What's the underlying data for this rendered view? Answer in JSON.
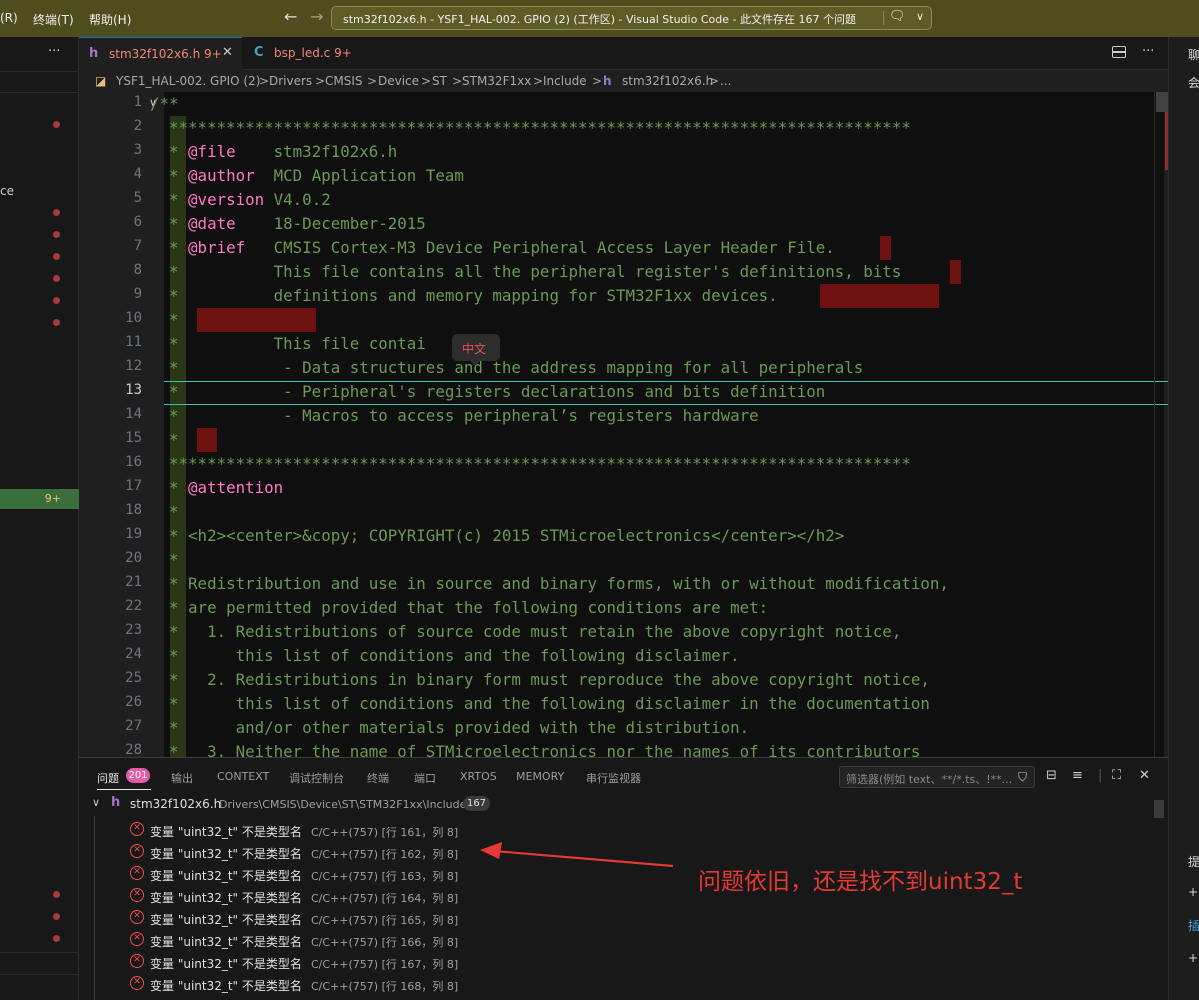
{
  "titlebar": {
    "menu_items": [
      "(R)",
      "终端(T)",
      "帮助(H)"
    ],
    "window_title": "stm32f102x6.h - YSF1_HAL-002. GPIO (2) (工作区) - Visual Studio Code - 此文件存在 167 个问题",
    "back_icon": "arrow-left-icon",
    "forward_icon": "arrow-right-icon"
  },
  "sidebar": {
    "more": "···",
    "fragment": "ce",
    "active_badge": "9+"
  },
  "tabs": [
    {
      "name": "stm32f102x6.h",
      "badge": "9+",
      "icon": "h",
      "close": "✕"
    },
    {
      "name": "bsp_led.c",
      "badge": "9+",
      "icon": "C"
    }
  ],
  "tabs_more": "···",
  "breadcrumb": [
    "YSF1_HAL-002. GPIO (2)",
    "Drivers",
    "CMSIS",
    "Device",
    "ST",
    "STM32F1xx",
    "Include",
    "stm32f102x6.h",
    "..."
  ],
  "breadcrumb_sep": ">",
  "breadcrumb_file_icon": "h",
  "editor": {
    "active_line": 13,
    "fold_icon": "∨",
    "tooltip": "中文",
    "lines": [
      {
        "num": "1",
        "text": "/**"
      },
      {
        "num": "2",
        "text": "  ******************************************************************************"
      },
      {
        "num": "3",
        "pre": "  * ",
        "tag": "@file",
        "text": "    stm32f102x6.h"
      },
      {
        "num": "4",
        "pre": "  * ",
        "tag": "@author",
        "text": "  MCD Application Team"
      },
      {
        "num": "5",
        "pre": "  * ",
        "tag": "@version",
        "text": " V4.0.2"
      },
      {
        "num": "6",
        "pre": "  * ",
        "tag": "@date",
        "text": "    18-December-2015"
      },
      {
        "num": "7",
        "pre": "  * ",
        "tag": "@brief",
        "text": "   CMSIS Cortex-M3 Device Peripheral Access Layer Header File."
      },
      {
        "num": "8",
        "text": "  *          This file contains all the peripheral register's definitions, bits"
      },
      {
        "num": "9",
        "text": "  *          definitions and memory mapping for STM32F1xx devices."
      },
      {
        "num": "10",
        "text": "  *"
      },
      {
        "num": "11",
        "text": "  *          This file contai"
      },
      {
        "num": "12",
        "text": "  *           - Data structures and the address mapping for all peripherals"
      },
      {
        "num": "13",
        "text": "  *           - Peripheral's registers declarations and bits definition"
      },
      {
        "num": "14",
        "text": "  *           - Macros to access peripheral’s registers hardware"
      },
      {
        "num": "15",
        "text": "  *"
      },
      {
        "num": "16",
        "text": "  ******************************************************************************"
      },
      {
        "num": "17",
        "pre": "  * ",
        "tag": "@attention",
        "text": ""
      },
      {
        "num": "18",
        "text": "  *"
      },
      {
        "num": "19",
        "text": "  * <h2><center>&copy; COPYRIGHT(c) 2015 STMicroelectronics</center></h2>"
      },
      {
        "num": "20",
        "text": "  *"
      },
      {
        "num": "21",
        "text": "  * Redistribution and use in source and binary forms, with or without modification,"
      },
      {
        "num": "22",
        "text": "  * are permitted provided that the following conditions are met:"
      },
      {
        "num": "23",
        "text": "  *   1. Redistributions of source code must retain the above copyright notice,"
      },
      {
        "num": "24",
        "text": "  *      this list of conditions and the following disclaimer."
      },
      {
        "num": "25",
        "text": "  *   2. Redistributions in binary form must reproduce the above copyright notice,"
      },
      {
        "num": "26",
        "text": "  *      this list of conditions and the following disclaimer in the documentation"
      },
      {
        "num": "27",
        "text": "  *      and/or other materials provided with the distribution."
      },
      {
        "num": "28",
        "text": "  *   3. Neither the name of STMicroelectronics nor the names of its contributors"
      }
    ]
  },
  "panel": {
    "tabs": [
      "问题",
      "输出",
      "CONTEXT",
      "调试控制台",
      "终端",
      "端口",
      "XRTOS",
      "MEMORY",
      "串行监视器"
    ],
    "problems_badge": "201",
    "filter_placeholder": "筛选器(例如 text、**/*.ts、!**...",
    "file": {
      "name": "stm32f102x6.h",
      "path": "Drivers\\CMSIS\\Device\\ST\\STM32F1xx\\Include",
      "count": "167"
    },
    "problems": [
      {
        "msg": "变量 \"uint32_t\" 不是类型名",
        "src": "C/C++(757) [行 161，列 8]"
      },
      {
        "msg": "变量 \"uint32_t\" 不是类型名",
        "src": "C/C++(757) [行 162，列 8]"
      },
      {
        "msg": "变量 \"uint32_t\" 不是类型名",
        "src": "C/C++(757) [行 163，列 8]"
      },
      {
        "msg": "变量 \"uint32_t\" 不是类型名",
        "src": "C/C++(757) [行 164，列 8]"
      },
      {
        "msg": "变量 \"uint32_t\" 不是类型名",
        "src": "C/C++(757) [行 165，列 8]"
      },
      {
        "msg": "变量 \"uint32_t\" 不是类型名",
        "src": "C/C++(757) [行 166，列 8]"
      },
      {
        "msg": "变量 \"uint32_t\" 不是类型名",
        "src": "C/C++(757) [行 167，列 8]"
      },
      {
        "msg": "变量 \"uint32_t\" 不是类型名",
        "src": "C/C++(757) [行 168，列 8]"
      }
    ]
  },
  "right_strip": [
    "聊",
    "会",
    "提",
    "+",
    "插",
    "+"
  ],
  "annotation": "问题依旧，还是找不到uint32_t",
  "colors": {
    "titlebar": "#4f4d1d",
    "comment": "#6a9955",
    "doc_tag": "#ff79c6",
    "error": "#f14c4c",
    "annotation": "#e53935",
    "badge": "#e45ca5"
  }
}
